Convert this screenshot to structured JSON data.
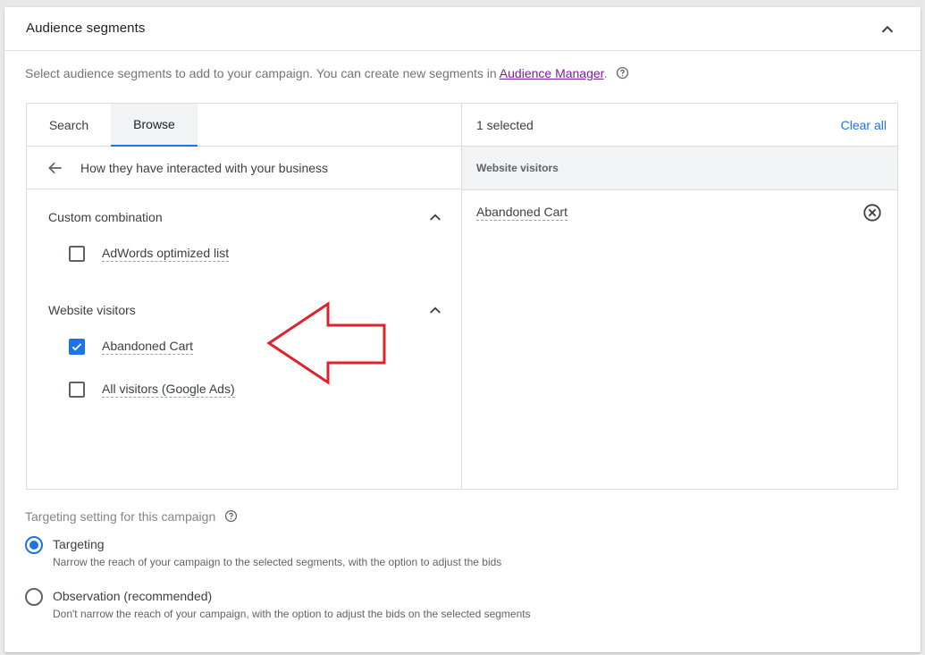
{
  "header": {
    "title": "Audience segments"
  },
  "intro": {
    "text": "Select audience segments to add to your campaign. You can create new segments in ",
    "link": "Audience Manager",
    "suffix": "."
  },
  "tabs": [
    {
      "label": "Search"
    },
    {
      "label": "Browse",
      "active": true
    }
  ],
  "breadcrumb": {
    "text": "How they have interacted with your business"
  },
  "groups": [
    {
      "title": "Custom combination",
      "items": [
        {
          "label": "AdWords optimized list",
          "checked": false
        }
      ]
    },
    {
      "title": "Website visitors",
      "items": [
        {
          "label": "Abandoned Cart",
          "checked": true
        },
        {
          "label": "All visitors (Google Ads)",
          "checked": false
        }
      ]
    }
  ],
  "selected": {
    "count_label": "1 selected",
    "clear_label": "Clear all",
    "group_label": "Website visitors",
    "items": [
      {
        "label": "Abandoned Cart"
      }
    ]
  },
  "targeting": {
    "label": "Targeting setting for this campaign",
    "options": [
      {
        "title": "Targeting",
        "desc": "Narrow the reach of your campaign to the selected segments, with the option to adjust the bids",
        "selected": true
      },
      {
        "title": "Observation (recommended)",
        "desc": "Don't narrow the reach of your campaign, with the option to adjust the bids on the selected segments",
        "selected": false
      }
    ]
  },
  "colors": {
    "accent": "#1a73e8",
    "annotation": "#e0202a",
    "link": "#7b1fa2"
  },
  "icons": [
    "chevron-up-icon",
    "help-icon",
    "back-arrow-icon",
    "checkbox-icon",
    "remove-circle-icon",
    "radio-icon",
    "annotation-arrow"
  ]
}
